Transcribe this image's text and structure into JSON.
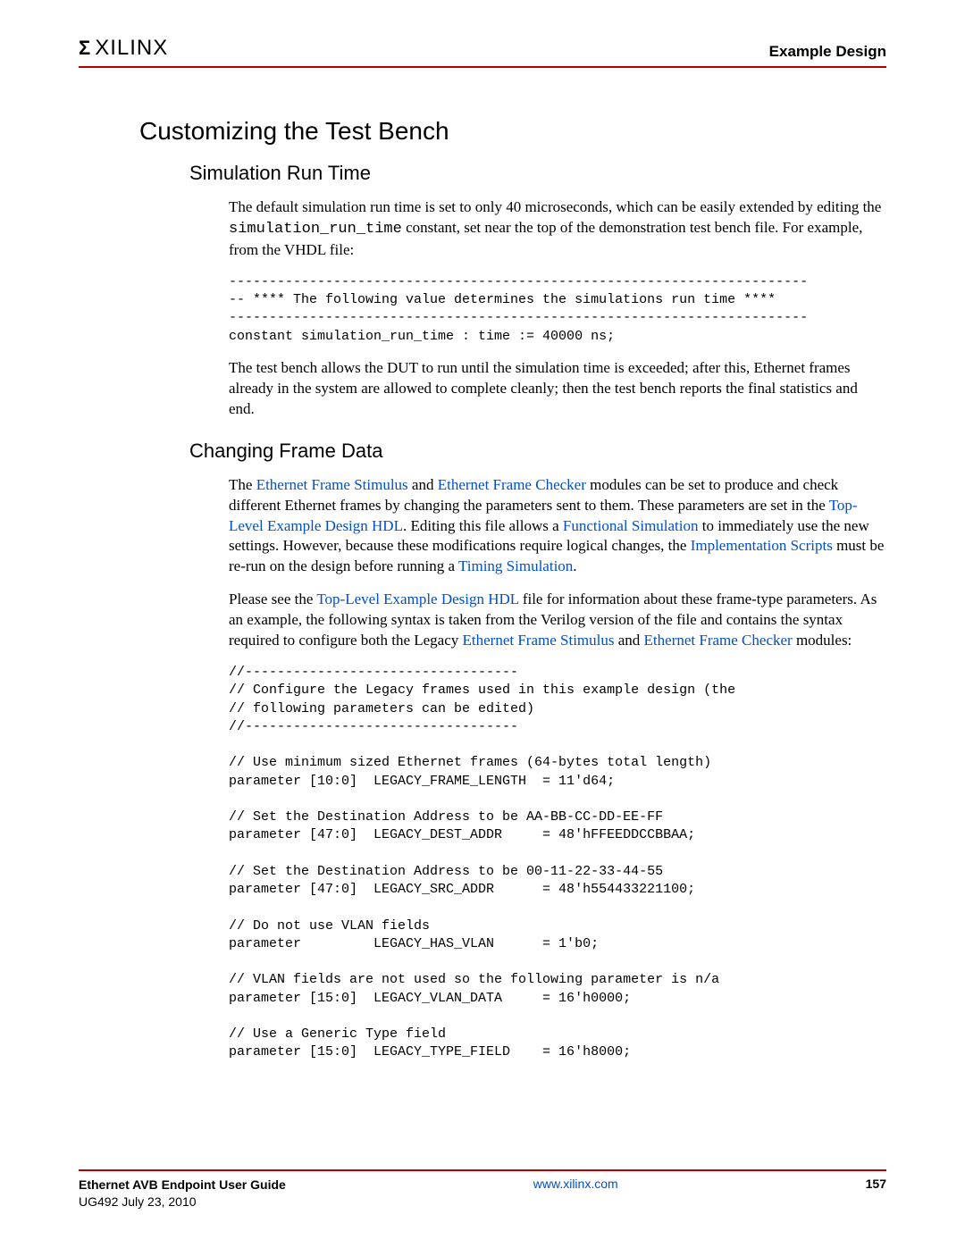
{
  "header": {
    "logo_mark": "Σ",
    "logo_text": "XILINX",
    "chapter": "Example Design"
  },
  "section_title": "Customizing the Test Bench",
  "sub1": {
    "title": "Simulation Run Time",
    "p1_a": "The default simulation run time is set to only 40 microseconds, which can be easily extended by editing the ",
    "p1_code": "simulation_run_time",
    "p1_b": " constant, set near the top of the demonstration test bench file. For example, from the VHDL file:",
    "code": "------------------------------------------------------------------------\n-- **** The following value determines the simulations run time ****\n------------------------------------------------------------------------\nconstant simulation_run_time : time := 40000 ns;",
    "p2": "The test bench allows the DUT to run until the simulation time is exceeded; after this, Ethernet frames already in the system are allowed to complete cleanly; then the test bench reports the final statistics and end."
  },
  "sub2": {
    "title": "Changing Frame Data",
    "p1": {
      "t1": "The ",
      "l1": "Ethernet Frame Stimulus",
      "t2": " and ",
      "l2": "Ethernet Frame Checker",
      "t3": " modules can be set to produce and check different Ethernet frames by changing the parameters sent to them. These parameters are set in the ",
      "l3": "Top-Level Example Design HDL",
      "t4": ". Editing this file allows a ",
      "l4": "Functional Simulation",
      "t5": " to immediately use the new settings. However, because these modifications require logical changes, the ",
      "l5": "Implementation Scripts",
      "t6": " must be re-run on the design before running a ",
      "l6": "Timing Simulation",
      "t7": "."
    },
    "p2": {
      "t1": "Please see the ",
      "l1": "Top-Level Example Design HDL",
      "t2": " file for information about these frame-type parameters. As an example, the following syntax is taken from the Verilog version of the file and contains the syntax required to configure both the Legacy ",
      "l2": "Ethernet Frame Stimulus",
      "t3": " and ",
      "l3": "Ethernet Frame Checker",
      "t4": " modules:"
    },
    "code": "//----------------------------------\n// Configure the Legacy frames used in this example design (the\n// following parameters can be edited)\n//----------------------------------\n\n// Use minimum sized Ethernet frames (64-bytes total length)\nparameter [10:0]  LEGACY_FRAME_LENGTH  = 11'd64;\n\n// Set the Destination Address to be AA-BB-CC-DD-EE-FF\nparameter [47:0]  LEGACY_DEST_ADDR     = 48'hFFEEDDCCBBAA;\n\n// Set the Destination Address to be 00-11-22-33-44-55\nparameter [47:0]  LEGACY_SRC_ADDR      = 48'h554433221100;\n\n// Do not use VLAN fields\nparameter         LEGACY_HAS_VLAN      = 1'b0;\n\n// VLAN fields are not used so the following parameter is n/a\nparameter [15:0]  LEGACY_VLAN_DATA     = 16'h0000;\n\n// Use a Generic Type field\nparameter [15:0]  LEGACY_TYPE_FIELD    = 16'h8000;"
  },
  "footer": {
    "guide_title": "Ethernet AVB Endpoint User Guide",
    "doc_line": "UG492 July 23, 2010",
    "url": "www.xilinx.com",
    "page": "157"
  }
}
